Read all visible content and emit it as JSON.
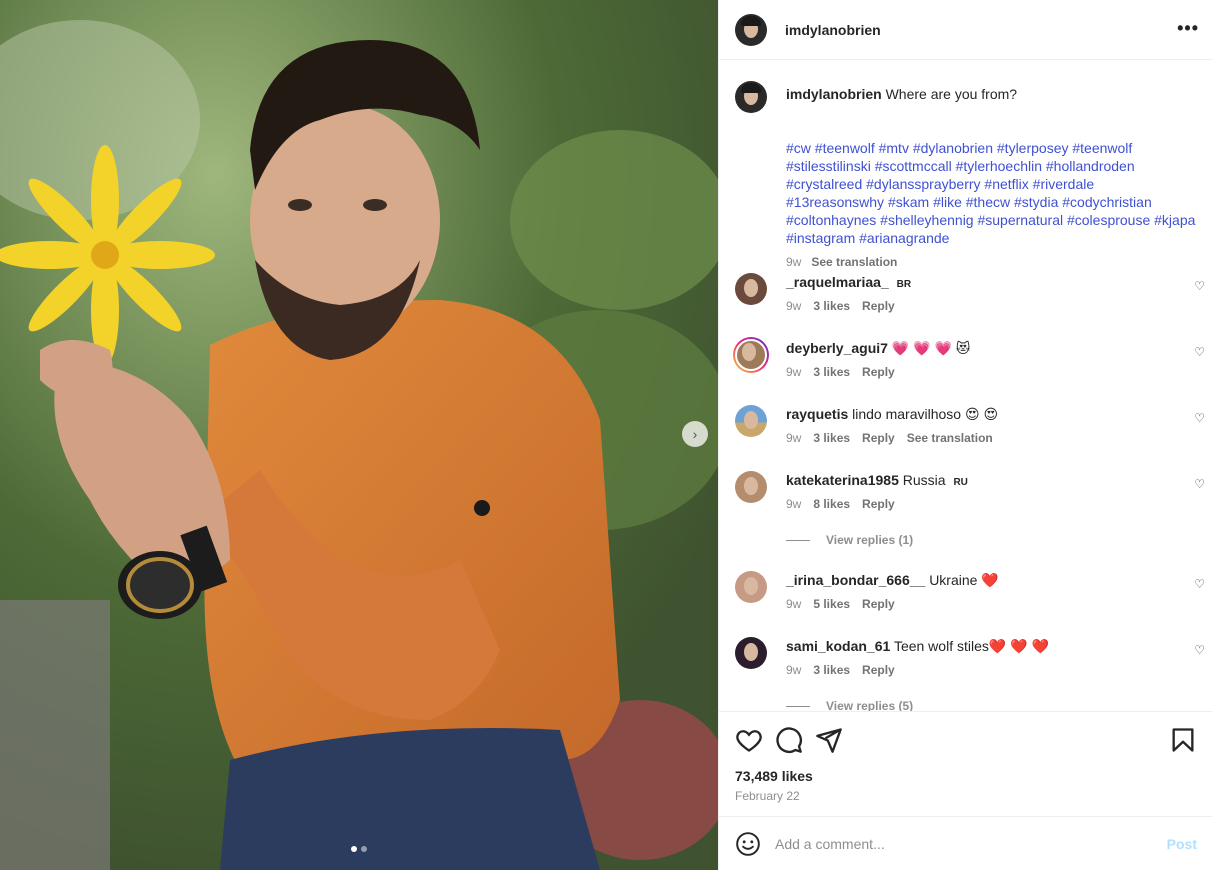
{
  "post": {
    "author": "imdylanobrien",
    "caption": "Where are you from?",
    "hashtags": "#cw #teenwolf #mtv #dylanobrien #tylerposey #teenwolf #stilesstilinski #scottmccall #tylerhoechlin #hollandroden #crystalreed #dylanssprayberry #netflix #riverdale #13reasonswhy #skam #like #thecw #stydia #codychristian #coltonhaynes #shelleyhennig #supernatural #colesprouse #kjapa #instagram #arianagrande",
    "caption_age": "9w",
    "see_translation": "See translation",
    "likes": "73,489 likes",
    "date": "February 22"
  },
  "comments": [
    {
      "user": "_raquelmariaa_",
      "text": "",
      "badge": "BR",
      "age": "9w",
      "likes": "3 likes",
      "reply": "Reply",
      "translate": ""
    },
    {
      "user": "deyberly_agui7",
      "text": "💗 💗 💗 😻",
      "badge": "",
      "age": "9w",
      "likes": "3 likes",
      "reply": "Reply",
      "translate": ""
    },
    {
      "user": "rayquetis",
      "text": "lindo maravilhoso 😍 😍",
      "badge": "",
      "age": "9w",
      "likes": "3 likes",
      "reply": "Reply",
      "translate": "See translation"
    },
    {
      "user": "katekaterina1985",
      "text": "Russia",
      "badge": "RU",
      "age": "9w",
      "likes": "8 likes",
      "reply": "Reply",
      "translate": ""
    },
    {
      "user": "_irina_bondar_666__",
      "text": "Ukraine ❤️",
      "badge": "",
      "age": "9w",
      "likes": "5 likes",
      "reply": "Reply",
      "translate": ""
    },
    {
      "user": "sami_kodan_61",
      "text": "Teen wolf stiles❤️ ❤️ ❤️",
      "badge": "",
      "age": "9w",
      "likes": "3 likes",
      "reply": "Reply",
      "translate": ""
    }
  ],
  "view_replies": [
    "View replies (1)",
    "View replies (5)"
  ],
  "add_comment": {
    "placeholder": "Add a comment...",
    "post_label": "Post"
  },
  "icons": {
    "more": "more-icon",
    "heart": "heart-icon",
    "comment": "comment-icon",
    "share": "share-icon",
    "save": "bookmark-icon",
    "emoji": "emoji-icon",
    "next": "chevron-right-icon"
  },
  "colors": {
    "hashtag": "#3f51d3",
    "post_disabled": "#b2dffc",
    "meta": "#8e8e8e"
  },
  "carousel": {
    "slides": 2,
    "current": 1
  }
}
